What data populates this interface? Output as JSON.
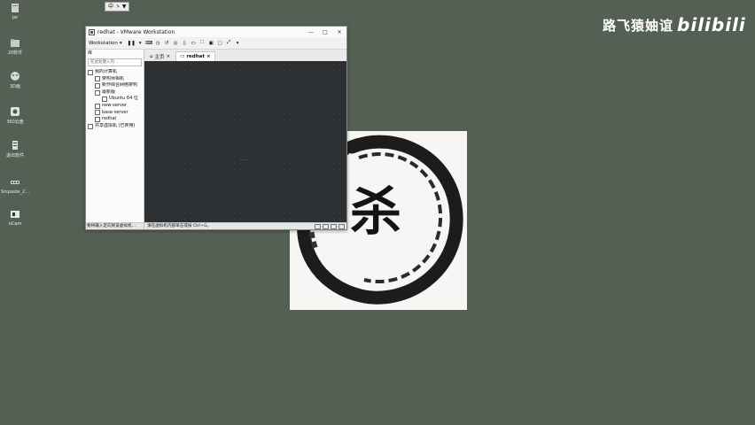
{
  "desktop": {
    "icons": [
      {
        "label": "jar",
        "name": "jar-icon"
      },
      {
        "label": "20软件",
        "name": "folder-icon"
      },
      {
        "label": "3D画",
        "name": "paint-icon"
      },
      {
        "label": "360云盘",
        "name": "cloud-icon"
      },
      {
        "label": "退出软件",
        "name": "exit-icon"
      },
      {
        "label": "Snipaste_2...",
        "name": "image-file-icon"
      },
      {
        "label": "oCam",
        "name": "camera-icon"
      }
    ]
  },
  "ime_indicator": "中 ゝ ▼",
  "watermark": {
    "text": "路飞猿妯谊",
    "logo": "bilibili"
  },
  "photo": {
    "glyph": "杀"
  },
  "vmware": {
    "title": "redhat - VMware Workstation",
    "menu_label": "Workstation",
    "library": {
      "header": "库",
      "search_placeholder": "在此处键入内...",
      "tree": [
        {
          "label": "我的计算机",
          "depth": 0
        },
        {
          "label": "架构师相机",
          "depth": 1
        },
        {
          "label": "新作综合网络架构",
          "depth": 1
        },
        {
          "label": "最新版",
          "depth": 1
        },
        {
          "label": "Ubuntu 64 位",
          "depth": 2
        },
        {
          "label": "new-server",
          "depth": 1
        },
        {
          "label": "base-server",
          "depth": 1
        },
        {
          "label": "redhat",
          "depth": 1
        },
        {
          "label": "共享虚拟机 (已弃用)",
          "depth": 0
        }
      ]
    },
    "tabs": [
      {
        "label": "主页",
        "active": false
      },
      {
        "label": "redhat",
        "active": true
      }
    ],
    "screen_text": "...",
    "status": {
      "left": "要将输入定向到该虚拟机...",
      "right": "请在虚拟机内部单击或按 Ctrl+G。"
    }
  },
  "colors": {
    "desktop": "#556055",
    "vm_screen": "#2c3033"
  }
}
